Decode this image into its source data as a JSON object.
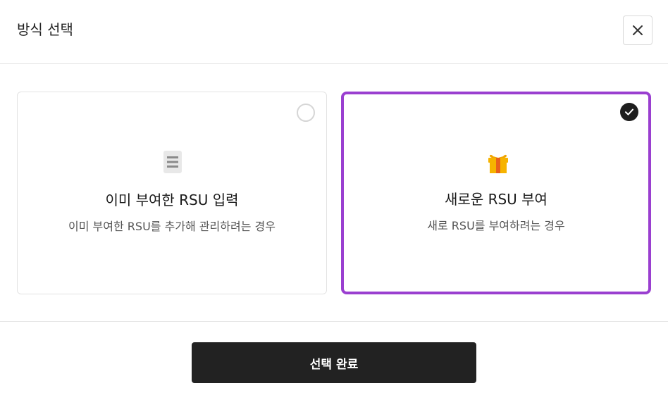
{
  "header": {
    "title": "방식 선택",
    "close_icon": "close-icon"
  },
  "options": [
    {
      "title": "이미 부여한 RSU 입력",
      "description": "이미 부여한 RSU를 추가해 관리하려는 경우",
      "icon": "document-list-icon",
      "selected": false
    },
    {
      "title": "새로운 RSU 부여",
      "description": "새로 RSU를 부여하려는 경우",
      "icon": "gift-icon",
      "selected": true
    }
  ],
  "footer": {
    "confirm_label": "선택 완료"
  },
  "colors": {
    "selected_border": "#9a3fd0",
    "button_bg": "#222222",
    "check_bg": "#1e1e1e"
  }
}
